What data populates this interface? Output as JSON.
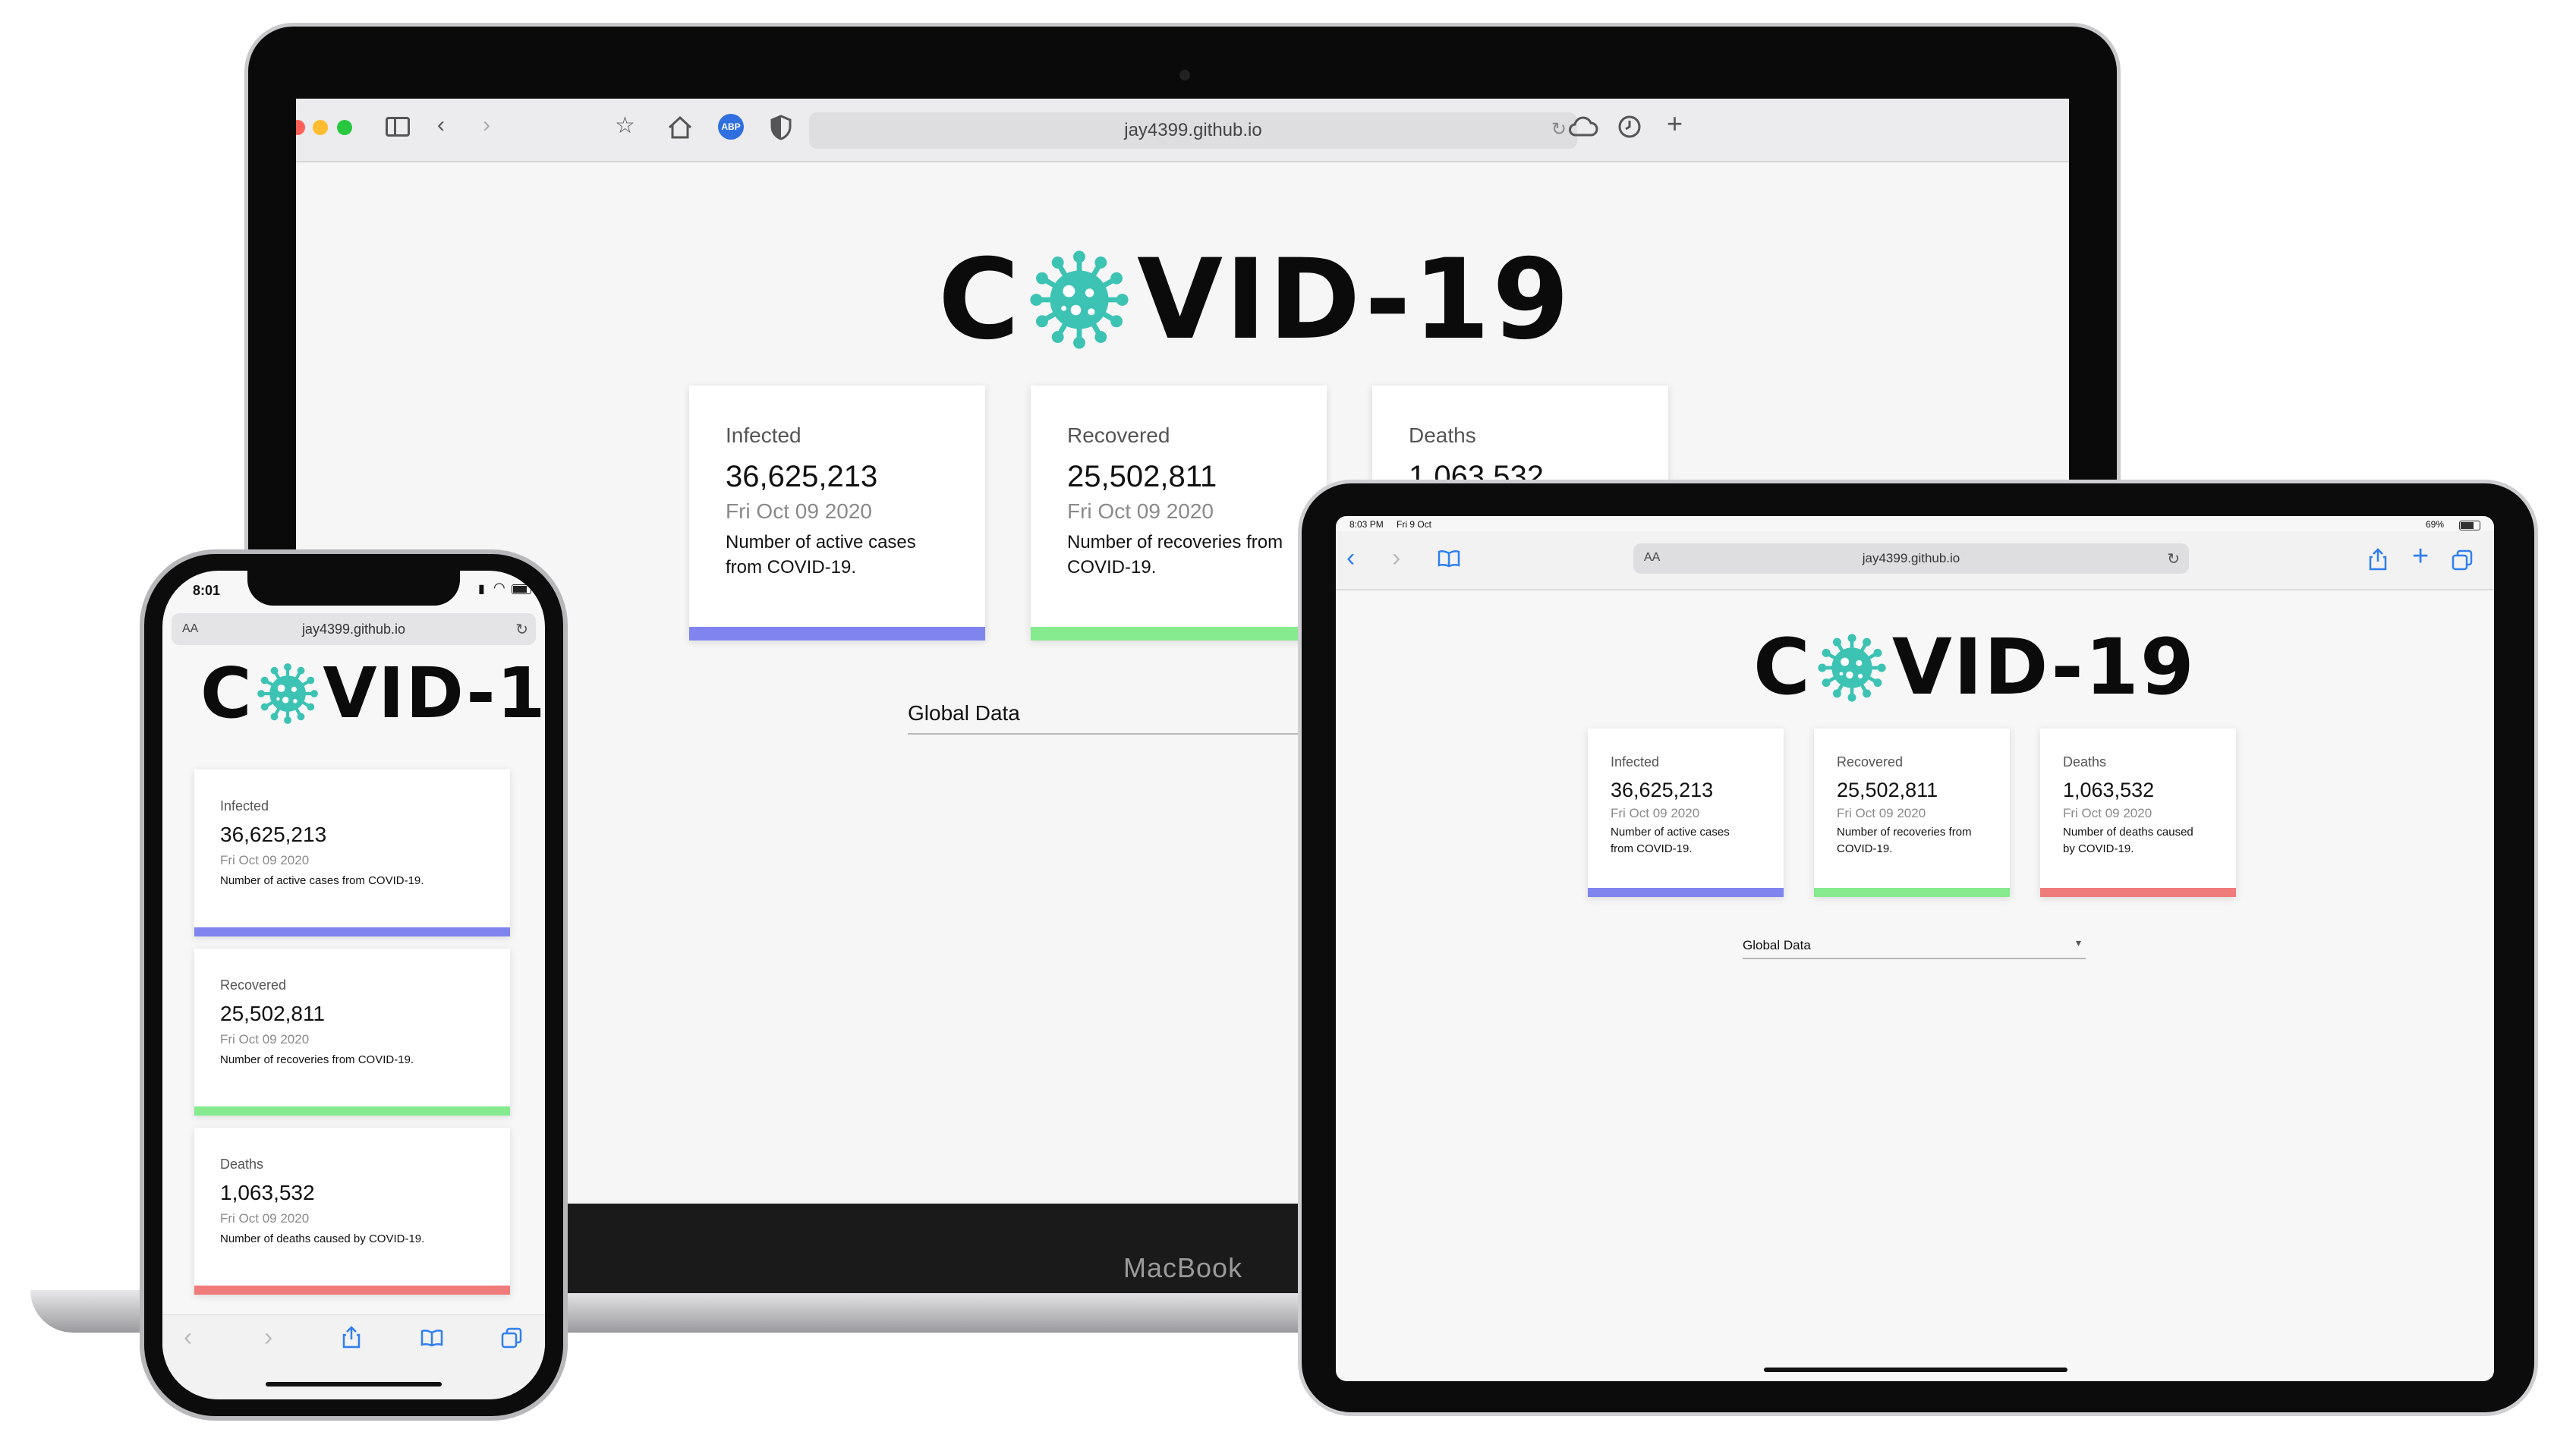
{
  "brand": {
    "title_left": "C",
    "title_right": "VID-19",
    "virus_icon": "virus-icon",
    "accent": "#3cc3b4"
  },
  "stats": {
    "infected": {
      "label": "Infected",
      "value": "36,625,213",
      "date": "Fri Oct 09 2020",
      "desc": "Number of active cases from COVID-19.",
      "color": "#7f84ee"
    },
    "recovered": {
      "label": "Recovered",
      "value": "25,502,811",
      "date": "Fri Oct 09 2020",
      "desc": "Number of recoveries from COVID-19.",
      "color": "#86ea8e"
    },
    "deaths": {
      "label": "Deaths",
      "value": "1,063,532",
      "date": "Fri Oct 09 2020",
      "desc": "Number of deaths caused by COVID-19.",
      "color": "#ef7b7b"
    }
  },
  "laptop": {
    "url": "jay4399.github.io",
    "brand_label": "MacBook",
    "icons": [
      "sidebar-icon",
      "back-icon",
      "forward-icon",
      "star-icon",
      "home-icon",
      "abp-icon",
      "shield-icon",
      "reload-icon",
      "cloud-icon",
      "clock-icon",
      "plus-icon"
    ],
    "abp": "ABP",
    "dropdown": "Global Data",
    "deaths_value_partial": "1,063,532"
  },
  "ipad": {
    "time": "8:03 PM",
    "date": "Fri 9 Oct",
    "battery": "69%",
    "aa": "AA",
    "url": "jay4399.github.io",
    "dropdown": "Global Data"
  },
  "phone": {
    "time": "8:01",
    "aa": "AA",
    "url": "jay4399.github.io"
  }
}
